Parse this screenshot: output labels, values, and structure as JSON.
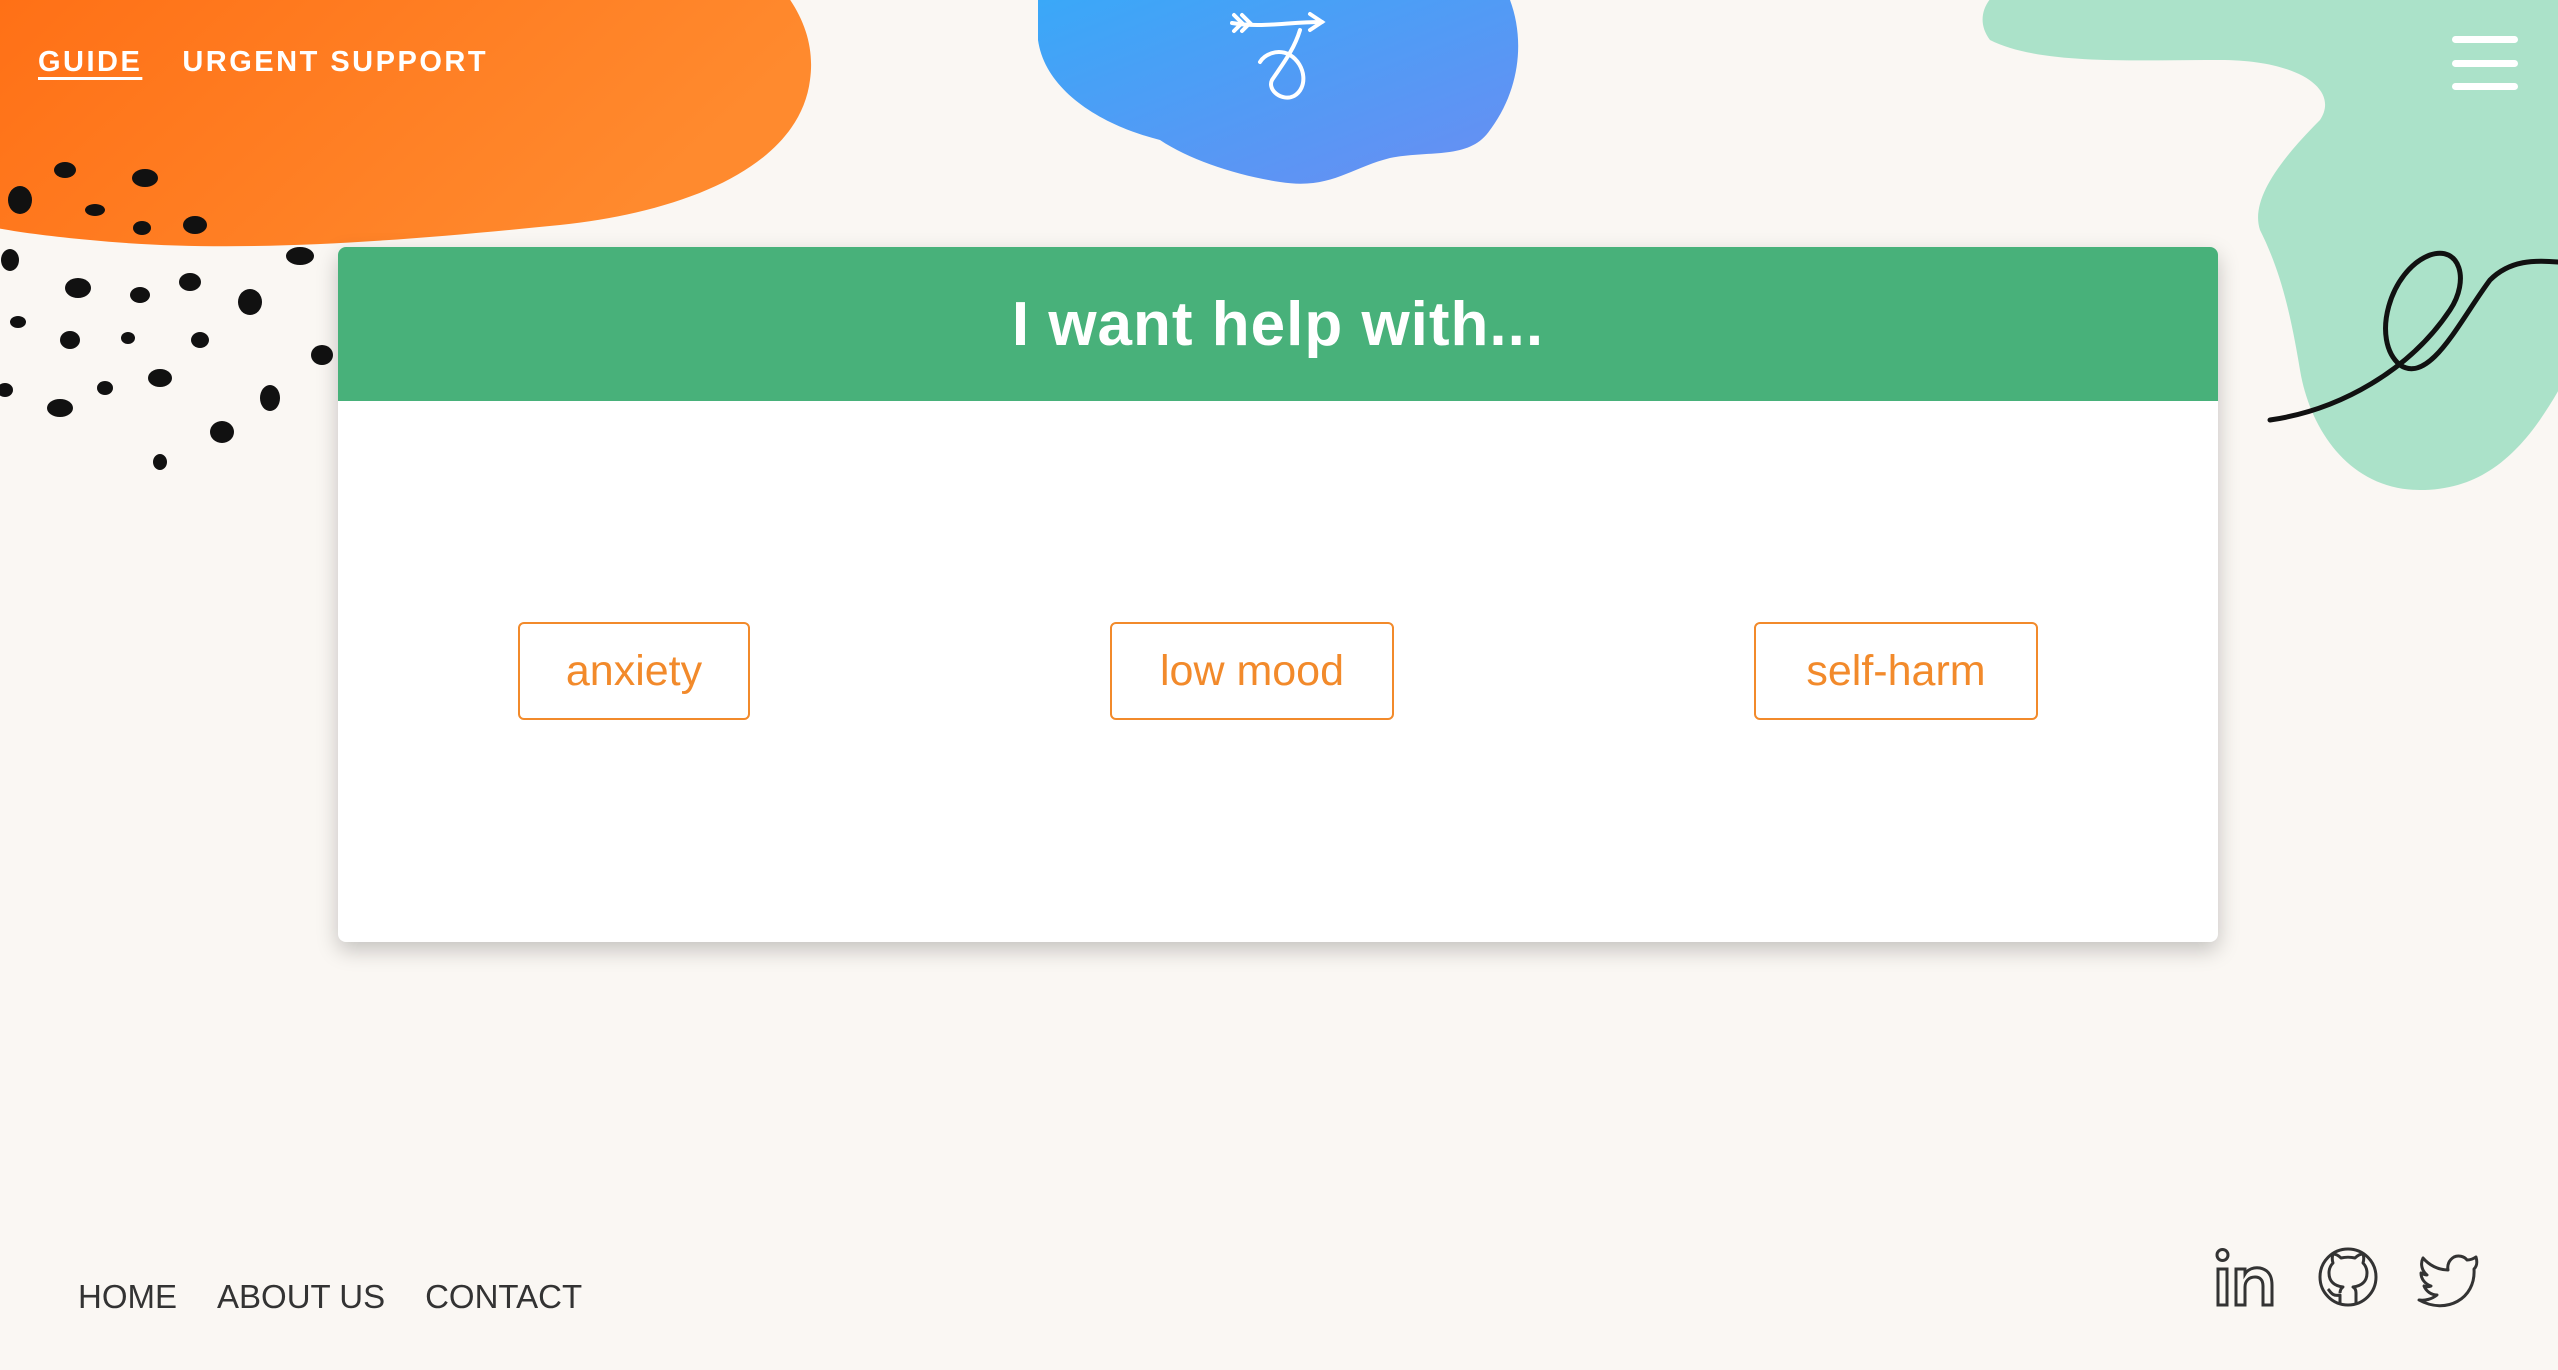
{
  "nav": {
    "links": [
      {
        "label": "GUIDE",
        "active": true
      },
      {
        "label": "URGENT SUPPORT",
        "active": false
      }
    ],
    "menu_icon": "hamburger-menu-icon"
  },
  "logo": {
    "icon": "arrow-loop-logo-icon"
  },
  "card": {
    "title": "I want help with...",
    "options": [
      "anxiety",
      "low mood",
      "self-harm"
    ]
  },
  "footer": {
    "links": [
      "HOME",
      "ABOUT US",
      "CONTACT"
    ],
    "social": [
      "linkedin-icon",
      "github-icon",
      "twitter-icon"
    ]
  },
  "colors": {
    "background": "#faf7f3",
    "header_green": "#48b17a",
    "accent_orange": "#f28a2b",
    "blob_orange": "#ff7a1e",
    "blob_blue": "#4a9cf5",
    "blob_green": "#a6e0c6"
  }
}
